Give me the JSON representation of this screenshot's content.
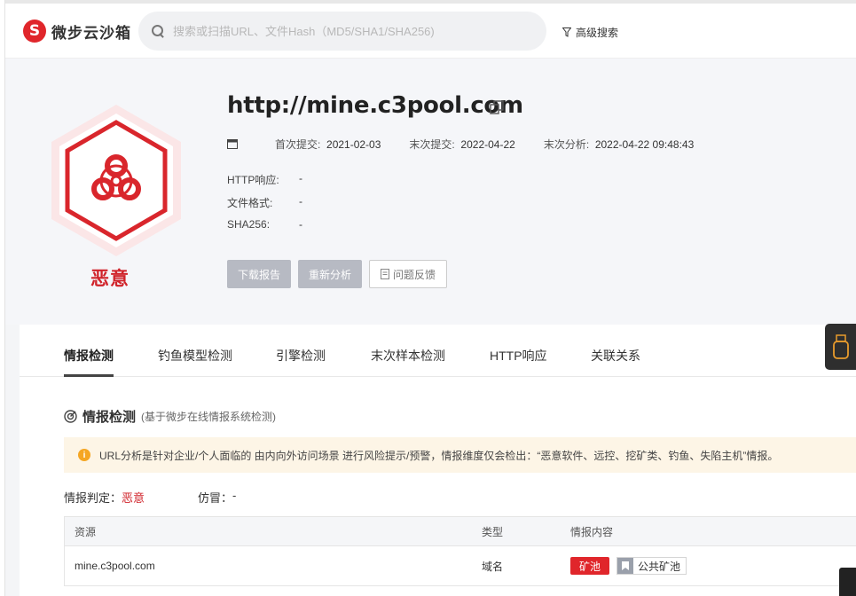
{
  "header": {
    "logo_glyph": "S",
    "logo_text": "微步云沙箱",
    "search_placeholder": "搜索或扫描URL、文件Hash（MD5/SHA1/SHA256)",
    "advanced_search": "高级搜索"
  },
  "summary": {
    "verdict": "恶意",
    "url": "http://mine.c3pool.com",
    "dates": [
      {
        "label": "首次提交:",
        "value": "2021-02-03"
      },
      {
        "label": "末次提交:",
        "value": "2022-04-22"
      },
      {
        "label": "末次分析:",
        "value": "2022-04-22 09:48:43"
      }
    ],
    "meta": [
      {
        "label": "HTTP响应:",
        "value": "-"
      },
      {
        "label": "文件格式:",
        "value": "-"
      },
      {
        "label": "SHA256:",
        "value": "-"
      }
    ],
    "buttons": {
      "download": "下载报告",
      "reanalyze": "重新分析",
      "feedback": "问题反馈"
    }
  },
  "tabs": [
    "情报检测",
    "钓鱼模型检测",
    "引擎检测",
    "末次样本检测",
    "HTTP响应",
    "关联关系"
  ],
  "intel": {
    "title": "情报检测",
    "subtitle": "(基于微步在线情报系统检测)",
    "notice": "URL分析是针对企业/个人面临的 由内向外访问场景 进行风险提示/预警，情报维度仅会检出：“恶意软件、远控、挖矿类、钓鱼、失陷主机”情报。",
    "judge_label": "情报判定：",
    "judge_value": "恶意",
    "fake_label": "仿冒：",
    "fake_value": "-",
    "table": {
      "headers": [
        "资源",
        "类型",
        "情报内容"
      ],
      "rows": [
        {
          "resource": "mine.c3pool.com",
          "type": "域名",
          "tag": "矿池",
          "pool_tag": "公共矿池"
        }
      ]
    }
  },
  "colors": {
    "malicious": "#d0232a",
    "accent_red": "#e0262b"
  }
}
